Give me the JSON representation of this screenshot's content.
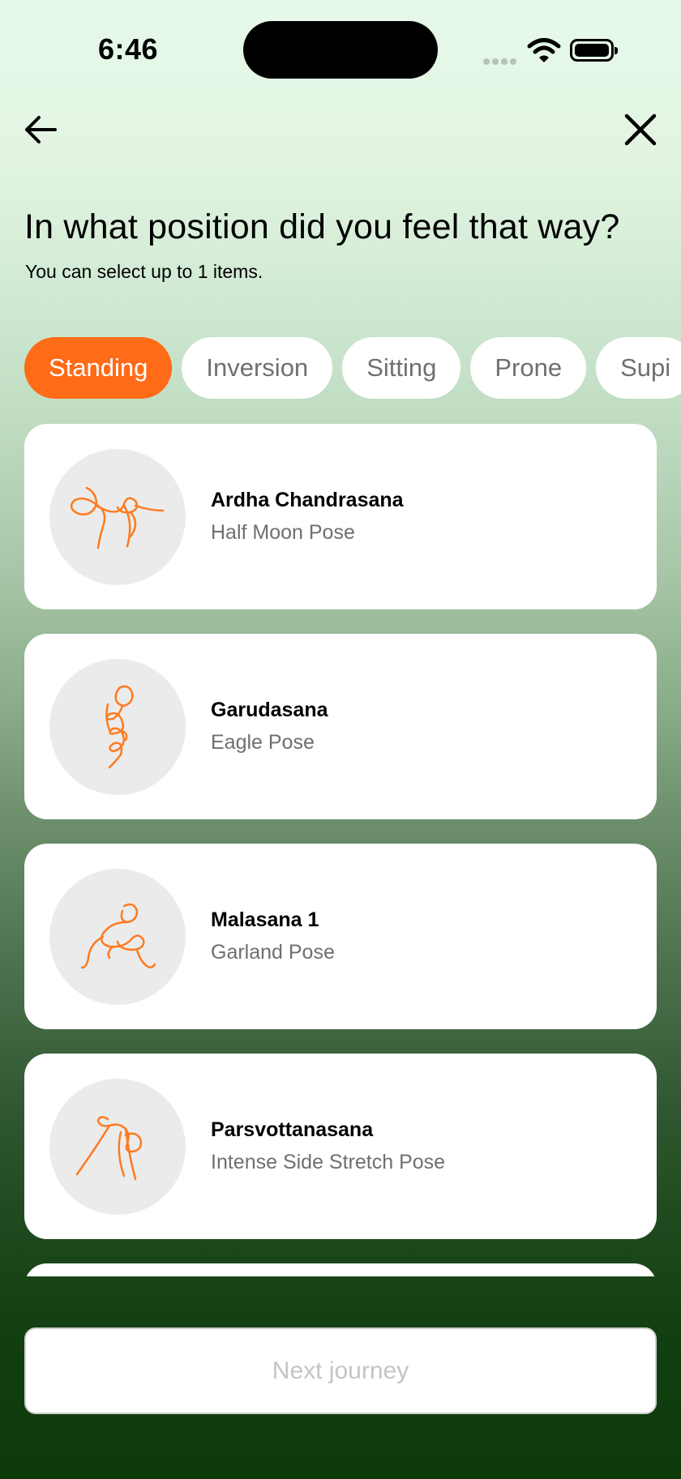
{
  "status_bar": {
    "time": "6:46"
  },
  "header": {
    "back_icon": "arrow-left-icon",
    "close_icon": "close-icon"
  },
  "question": {
    "title": "In what position did you feel that way?",
    "subtitle": "You can select up to 1 items."
  },
  "categories": [
    {
      "label": "Standing",
      "selected": true
    },
    {
      "label": "Inversion",
      "selected": false
    },
    {
      "label": "Sitting",
      "selected": false
    },
    {
      "label": "Prone",
      "selected": false
    },
    {
      "label": "Supi",
      "selected": false
    }
  ],
  "poses": [
    {
      "name": "Ardha Chandrasana",
      "english": "Half Moon Pose",
      "icon": "half-moon-pose-icon"
    },
    {
      "name": "Garudasana",
      "english": "Eagle Pose",
      "icon": "eagle-pose-icon"
    },
    {
      "name": "Malasana 1",
      "english": "Garland Pose",
      "icon": "garland-pose-icon"
    },
    {
      "name": "Parsvottanasana",
      "english": "Intense Side Stretch Pose",
      "icon": "intense-side-stretch-pose-icon"
    }
  ],
  "footer": {
    "next_label": "Next journey"
  },
  "colors": {
    "accent": "#ff6b17",
    "card": "#ffffff",
    "thumb_bg": "#ebebeb",
    "subtext": "#6f6f6f"
  }
}
